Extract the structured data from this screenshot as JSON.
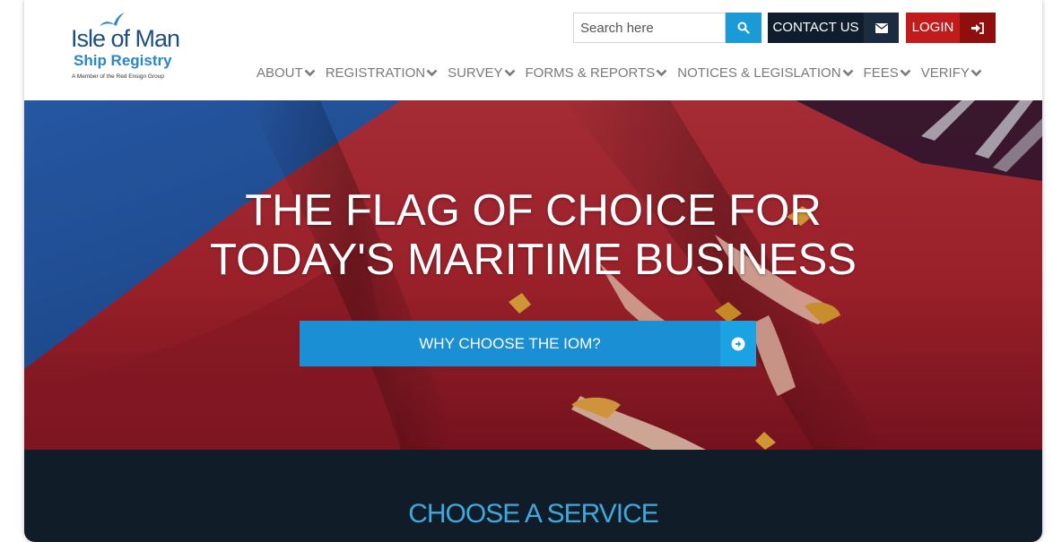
{
  "logo": {
    "title": "Isle of Man",
    "subtitle": "Ship Registry",
    "tagline": "A Member of the Red Ensign Group"
  },
  "search": {
    "placeholder": "Search here"
  },
  "contact": {
    "label": "CONTACT US"
  },
  "login": {
    "label": "LOGIN"
  },
  "nav": {
    "items": [
      {
        "label": "ABOUT"
      },
      {
        "label": "REGISTRATION"
      },
      {
        "label": "SURVEY"
      },
      {
        "label": "FORMS & REPORTS"
      },
      {
        "label": "NOTICES & LEGISLATION"
      },
      {
        "label": "FEES"
      },
      {
        "label": "VERIFY"
      }
    ]
  },
  "hero": {
    "title_line1": "THE FLAG OF CHOICE FOR",
    "title_line2": "TODAY'S MARITIME BUSINESS",
    "cta_label": "WHY CHOOSE THE IOM?"
  },
  "service": {
    "title": "CHOOSE A SERVICE"
  },
  "colors": {
    "brand_dark": "#0f1d2e",
    "accent_blue": "#1a9ad6",
    "login_red": "#c11b1b",
    "service_title": "#3ea9de"
  }
}
